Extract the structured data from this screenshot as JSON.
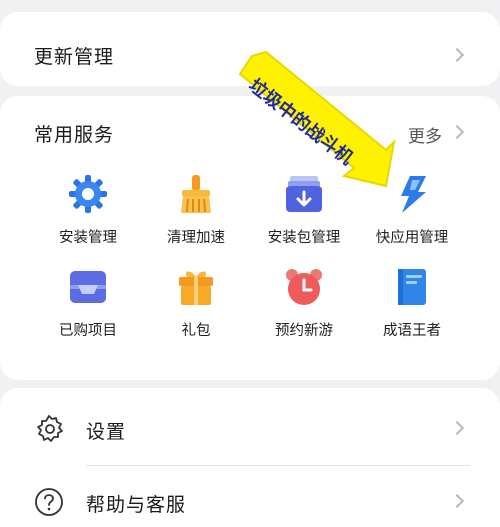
{
  "update": {
    "title": "更新管理"
  },
  "services": {
    "title": "常用服务",
    "more_label": "更多",
    "items": [
      {
        "label": "安装管理",
        "icon": "install-gear-icon"
      },
      {
        "label": "清理加速",
        "icon": "broom-icon"
      },
      {
        "label": "安装包管理",
        "icon": "package-download-icon"
      },
      {
        "label": "快应用管理",
        "icon": "quick-app-icon"
      },
      {
        "label": "已购项目",
        "icon": "purchased-tray-icon"
      },
      {
        "label": "礼包",
        "icon": "gift-icon"
      },
      {
        "label": "预约新游",
        "icon": "alarm-clock-icon"
      },
      {
        "label": "成语王者",
        "icon": "book-icon"
      }
    ]
  },
  "settings": {
    "items": [
      {
        "label": "设置",
        "icon": "gear-outline-icon"
      },
      {
        "label": "帮助与客服",
        "icon": "help-circle-icon"
      }
    ]
  },
  "annotation": {
    "text": "垃圾中的战斗机",
    "color": "#fff200"
  }
}
